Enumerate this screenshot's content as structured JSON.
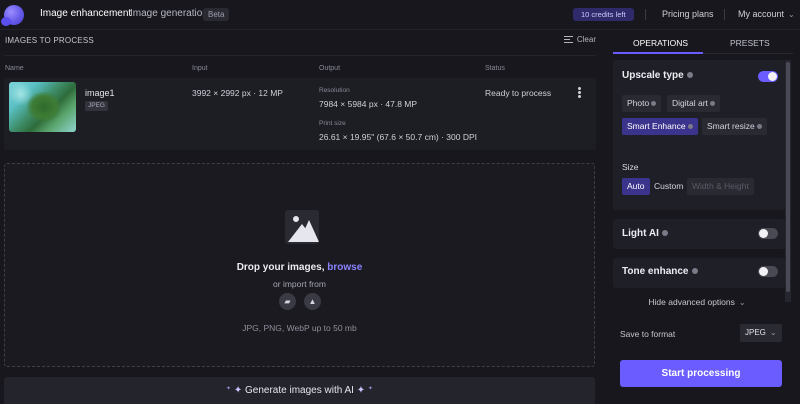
{
  "nav": {
    "items": [
      "Image enhancement",
      "Image generation"
    ],
    "beta": "Beta",
    "credits": "10 credits left",
    "pricing": "Pricing plans",
    "account": "My account"
  },
  "queue": {
    "title": "IMAGES TO PROCESS",
    "clear": "Clear",
    "columns": [
      "Name",
      "Input",
      "Output",
      "Status"
    ],
    "rows": [
      {
        "name": "image1",
        "format": "JPEG",
        "input": "3992 × 2992 px · 12 MP",
        "resolution_label": "Resolution",
        "resolution": "7984 × 5984 px · 47.8 MP",
        "print_label": "Print size",
        "print": "26.61 × 19.95\" (67.6 × 50.7 cm) · 300 DPI",
        "status": "Ready to process"
      }
    ]
  },
  "dropzone": {
    "title": "Drop your images,",
    "browse": "browse",
    "import": "or import from",
    "formats": "JPG, PNG, WebP up to 50 mb"
  },
  "generate": {
    "label": "Generate images with AI"
  },
  "panel": {
    "tabs": [
      "OPERATIONS",
      "PRESETS"
    ],
    "upscale": {
      "title": "Upscale type",
      "enabled": true,
      "types": [
        "Photo",
        "Digital art",
        "Smart Enhance",
        "Smart resize"
      ],
      "selected": "Smart Enhance"
    },
    "size": {
      "title": "Size",
      "options": [
        "Auto",
        "Custom",
        "Width & Height"
      ],
      "selected": "Auto"
    },
    "light_ai": {
      "title": "Light AI",
      "enabled": false
    },
    "tone": {
      "title": "Tone enhance",
      "enabled": false
    },
    "advanced": "Hide advanced options",
    "format_label": "Save to format",
    "format_value": "JPEG",
    "start": "Start processing"
  },
  "colors": {
    "accent": "#6a5cff",
    "background": "#17171d",
    "card": "#1f1f27"
  }
}
